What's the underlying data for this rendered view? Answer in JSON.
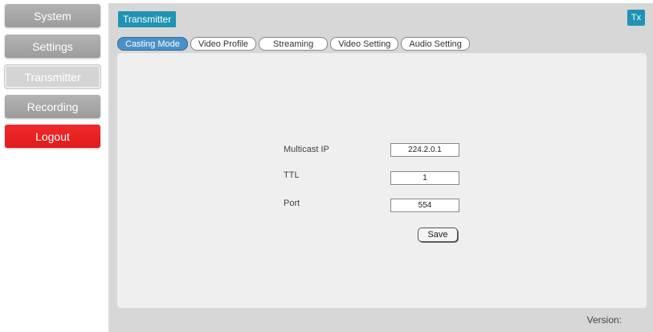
{
  "sidebar": {
    "items": [
      {
        "label": "System"
      },
      {
        "label": "Settings"
      },
      {
        "label": "Transmitter"
      },
      {
        "label": "Recording"
      },
      {
        "label": "Logout"
      }
    ]
  },
  "header": {
    "title": "Transmitter",
    "badge": "Tx"
  },
  "tabs": [
    {
      "label": "Casting Mode",
      "active": true
    },
    {
      "label": "Video Profile"
    },
    {
      "label": "Streaming"
    },
    {
      "label": "Video Setting"
    },
    {
      "label": "Audio Setting"
    }
  ],
  "form": {
    "multicast_ip": {
      "label": "Multicast IP",
      "value": "224.2.0.1"
    },
    "ttl": {
      "label": "TTL",
      "value": "1"
    },
    "port": {
      "label": "Port",
      "value": "554"
    },
    "save_label": "Save"
  },
  "footer": {
    "version_label": "Version:"
  },
  "colors": {
    "accent": "#1f93b3",
    "active_tab": "#4a90c8",
    "logout": "#e01b1b",
    "nav_gray": "#a6a6a6"
  }
}
